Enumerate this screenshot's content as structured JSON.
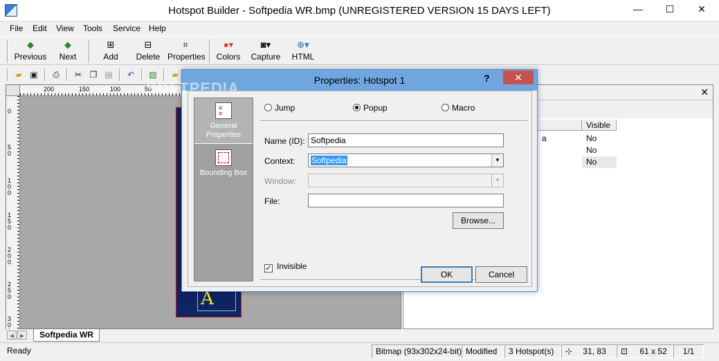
{
  "window": {
    "title": "Hotspot Builder - Softpedia WR.bmp (UNREGISTERED VERSION 15 DAYS LEFT)",
    "minimize": "—",
    "maximize": "☐",
    "close": "✕"
  },
  "menu": [
    "File",
    "Edit",
    "View",
    "Tools",
    "Service",
    "Help"
  ],
  "toolbar": {
    "previous": "Previous",
    "next": "Next",
    "add": "Add",
    "delete": "Delete",
    "properties": "Properties",
    "colors": "Colors",
    "capture": "Capture",
    "html": "HTML"
  },
  "watermark": "SOFTPEDIA",
  "ruler": {
    "h_labels": [
      "200",
      "150",
      "100",
      "50"
    ],
    "v_labels": [
      "0",
      "50",
      "100",
      "150",
      "200",
      "250",
      "300"
    ]
  },
  "bitmap": {
    "letter": "A"
  },
  "hotspot_list": {
    "visible_header": "Visible",
    "visible_values": [
      "No",
      "No",
      "No"
    ],
    "name_fragment": "a"
  },
  "sheet_tab": "Softpedia WR",
  "status": {
    "ready": "Ready",
    "bitmap": "Bitmap (93x302x24-bit)",
    "modified": "Modified",
    "hotspots": "3 Hotspot(s)",
    "position": "31, 83",
    "size": "61 x 52",
    "page": "1/1"
  },
  "dialog": {
    "title": "Properties: Hotspot 1",
    "help": "?",
    "close": "✕",
    "sidebar": {
      "general": "General Properties",
      "bounding": "Bounding Box"
    },
    "type": {
      "jump": "Jump",
      "popup": "Popup",
      "macro": "Macro",
      "selected": "popup"
    },
    "fields": {
      "name_label": "Name (ID):",
      "name_value": "Softpedia",
      "context_label": "Context:",
      "context_value": "Softpedia",
      "window_label": "Window:",
      "window_value": "",
      "file_label": "File:",
      "file_value": ""
    },
    "browse": "Browse...",
    "invisible_label": "Invisible",
    "invisible_checked": true,
    "ok": "OK",
    "cancel": "Cancel"
  }
}
